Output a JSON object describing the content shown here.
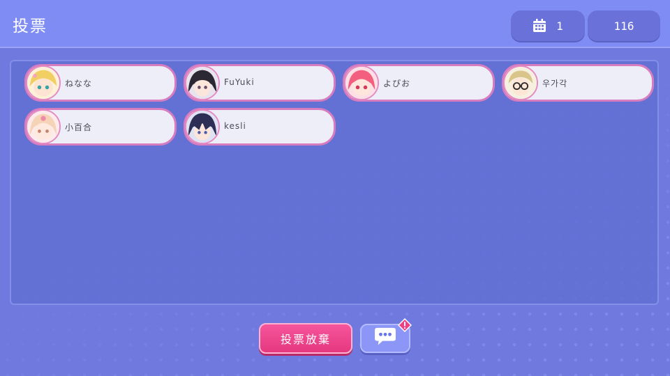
{
  "header": {
    "title": "投票",
    "day": "1",
    "count": "116"
  },
  "players": [
    {
      "name": "ねなな"
    },
    {
      "name": "FuYuki"
    },
    {
      "name": "よぴお"
    },
    {
      "name": "우가각"
    },
    {
      "name": "小百合"
    },
    {
      "name": "kesli"
    }
  ],
  "footer": {
    "give_up_label": "投票放棄"
  },
  "icons": {
    "day": "calendar-icon",
    "chat": "chat-bubble-icon",
    "alert": "alert-icon"
  },
  "colors": {
    "background": "#6f79de",
    "header": "#7f8cf3",
    "player_border": "#d77cbf",
    "give_up": "#f04b92",
    "chat": "#8b96f6"
  }
}
